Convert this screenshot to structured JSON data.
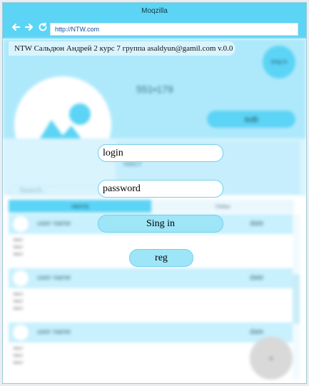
{
  "window": {
    "title": "Moqzilla",
    "url": "http://NTW.com"
  },
  "info_strip": "NTW Сальдюн Андрей 2 курс 7 группа  asaldyun@gamil.com  v.0.0",
  "profile": {
    "signin_top": "sing in",
    "phone": "551•179",
    "sub_label": "sub",
    "info_text": "текст"
  },
  "search_placeholder": "Search...",
  "tabs": [
    "лента",
    "темы"
  ],
  "cards": [
    {
      "name": "user name",
      "date": "date",
      "lines": [
        "текст",
        "текст",
        "текст"
      ]
    },
    {
      "name": "user name",
      "date": "date",
      "lines": [
        "текст",
        "текст",
        "текст"
      ]
    },
    {
      "name": "user name",
      "date": "date",
      "lines": [
        "текст",
        "текст",
        "текст"
      ]
    }
  ],
  "fab_label": "+",
  "login_form": {
    "login_placeholder": "login",
    "password_placeholder": "password",
    "signin_label": "Sing in",
    "reg_label": "reg"
  },
  "colors": {
    "accent": "#5cd4f5",
    "button": "#9ee5f7",
    "field_border": "#73d1ef"
  }
}
